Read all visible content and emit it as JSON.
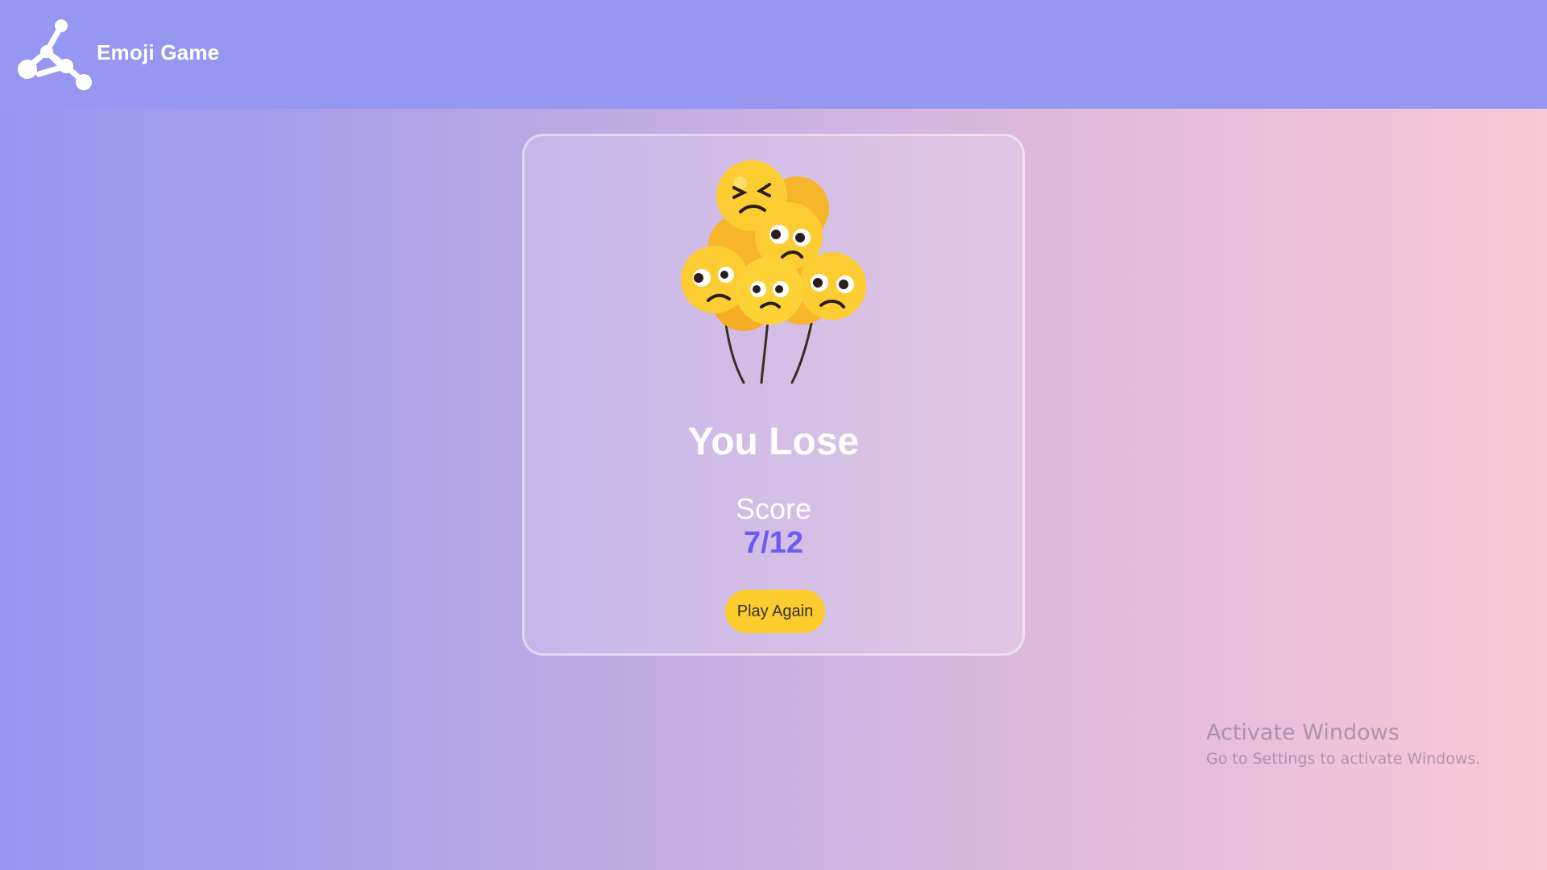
{
  "navbar": {
    "title": "Emoji Game",
    "logo_icon": "molecule-logo-icon",
    "background": "#9697f0"
  },
  "result": {
    "illustration_icon": "sad-emoji-balloons-icon",
    "title": "You Lose",
    "score_label": "Score",
    "score_value": "7/12",
    "play_again_label": "Play Again"
  },
  "colors": {
    "accent_score": "#6a5cf3",
    "button": "#fccb2e",
    "gradient_start": "#9596f1",
    "gradient_end": "#fac8d6"
  },
  "watermark": {
    "title": "Activate Windows",
    "subtitle": "Go to Settings to activate Windows."
  }
}
